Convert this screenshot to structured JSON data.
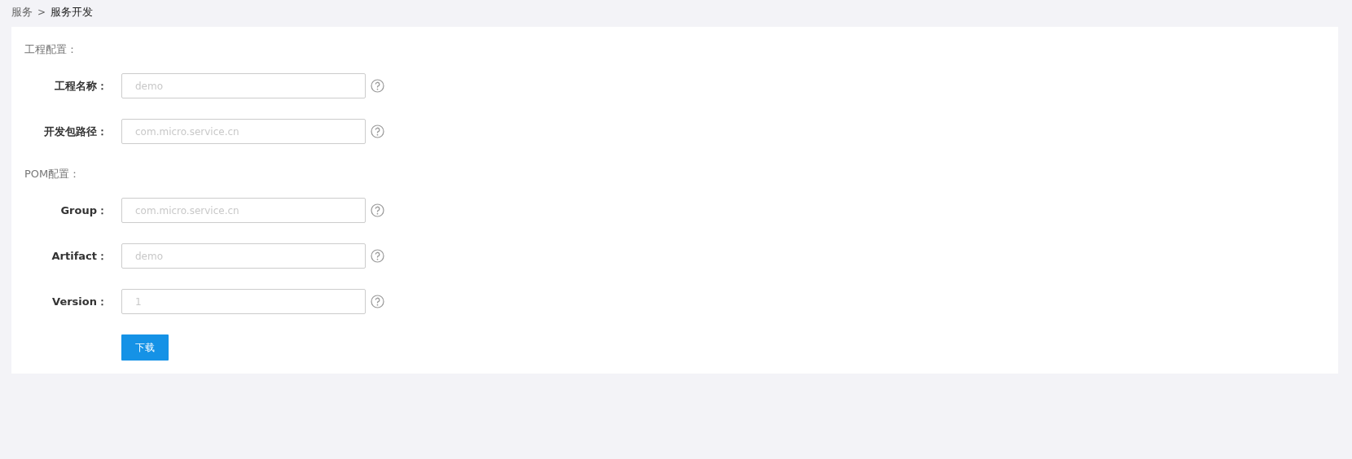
{
  "breadcrumb": [
    {
      "label": "服务",
      "current": false
    },
    {
      "label": "服务开发",
      "current": true
    }
  ],
  "breadcrumb_separator": ">",
  "sections": [
    {
      "title": "工程配置：",
      "fields": [
        {
          "label": "工程名称：",
          "placeholder": "demo"
        },
        {
          "label": "开发包路径：",
          "placeholder": "com.micro.service.cn"
        }
      ]
    },
    {
      "title": "POM配置：",
      "fields": [
        {
          "label": "Group：",
          "placeholder": "com.micro.service.cn"
        },
        {
          "label": "Artifact：",
          "placeholder": "demo"
        },
        {
          "label": "Version：",
          "placeholder": "1"
        }
      ]
    }
  ],
  "submit_button": "下载"
}
